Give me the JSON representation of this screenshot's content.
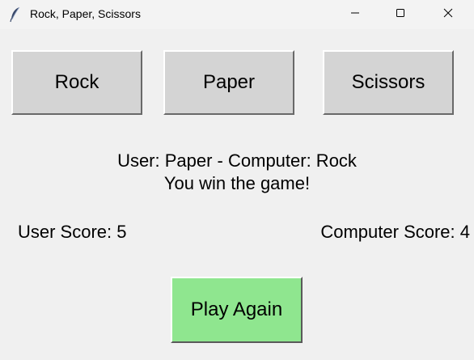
{
  "window": {
    "title": "Rock, Paper, Scissors"
  },
  "choices": {
    "rock_label": "Rock",
    "paper_label": "Paper",
    "scissors_label": "Scissors"
  },
  "result": {
    "choices_text": "User: Paper - Computer: Rock",
    "outcome_text": "You win the game!"
  },
  "scores": {
    "user_text": "User Score: 5",
    "computer_text": "Computer Score: 4"
  },
  "play_again": {
    "label": "Play Again",
    "color": "#8fe68f"
  },
  "icons": {
    "app": "feather-icon",
    "minimize": "minimize-icon",
    "maximize": "maximize-icon",
    "close": "close-icon"
  }
}
